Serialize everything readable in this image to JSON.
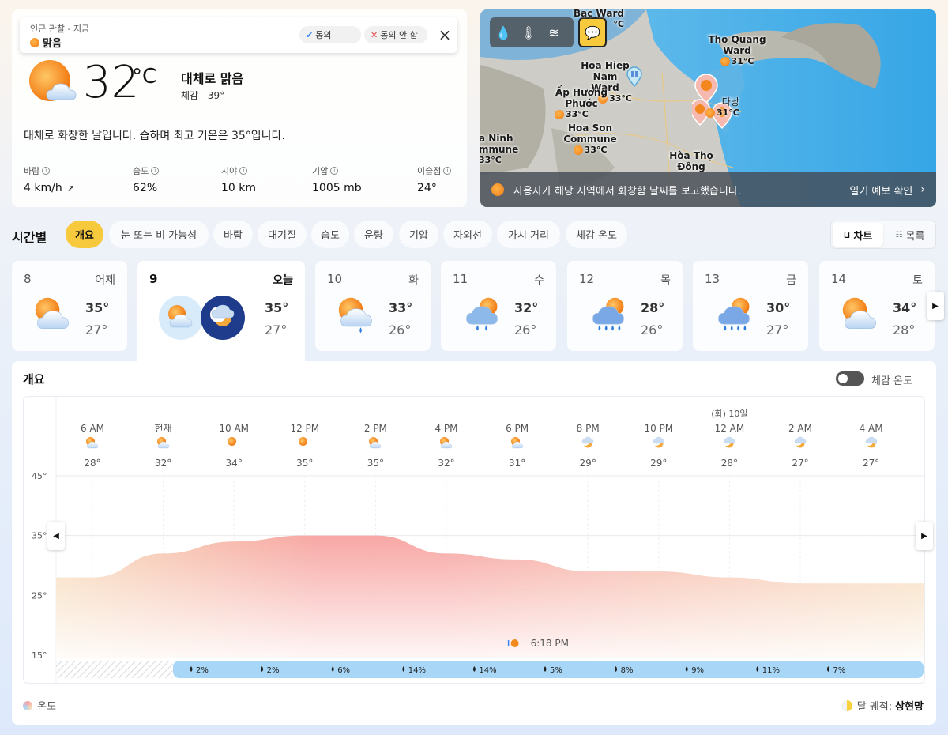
{
  "current": {
    "observation_title": "인근 관찰 - 지금",
    "observation_condition": "맑음",
    "agree_label": "동의",
    "disagree_label": "동의 안 함",
    "temperature": "32",
    "unit": "°C",
    "condition": "대체로 맑음",
    "feels_like_label": "체감",
    "feels_like_value": "39°",
    "description": "대체로 화창한 날입니다. 습하며 최고 기온은 35°입니다.",
    "metrics": [
      {
        "label": "바람",
        "value": "4 km/h"
      },
      {
        "label": "습도",
        "value": "62%"
      },
      {
        "label": "시야",
        "value": "10 km"
      },
      {
        "label": "기압",
        "value": "1005 mb"
      },
      {
        "label": "이슬점",
        "value": "24°"
      }
    ]
  },
  "map": {
    "places": [
      {
        "name": "Bac Ward",
        "temp": "°C"
      },
      {
        "name": "Tho Quang Ward",
        "temp": "31°C"
      },
      {
        "name": "Hoa Hiep Nam Ward",
        "temp": "33°C"
      },
      {
        "name": "Ấp Hương Phước",
        "temp": "33°C"
      },
      {
        "name": "다낭",
        "temp": "31°C"
      },
      {
        "name": "Hoa Son Commune",
        "temp": "33°C"
      },
      {
        "name": "a Ninh mmune",
        "temp": "33°C"
      },
      {
        "name": "Hòa Thọ Đông",
        "temp": ""
      }
    ],
    "footer_text": "사용자가 해당 지역에서 화창함 날씨를 보고했습니다.",
    "footer_link": "일기 예보 확인"
  },
  "hourly": {
    "title": "시간별",
    "tabs": [
      "개요",
      "눈 또는 비 가능성",
      "바람",
      "대기질",
      "습도",
      "운량",
      "기압",
      "자외선",
      "가시 거리",
      "체감 온도"
    ],
    "active_tab": 0,
    "view_chart": "차트",
    "view_list": "목록"
  },
  "days": [
    {
      "num": "8",
      "name": "어제",
      "hi": "35°",
      "lo": "27°",
      "icon": "partly-sunny"
    },
    {
      "num": "9",
      "name": "오늘",
      "hi": "35°",
      "lo": "27°",
      "icon": "partly-sunny-night"
    },
    {
      "num": "10",
      "name": "화",
      "hi": "33°",
      "lo": "26°",
      "icon": "sun-rain"
    },
    {
      "num": "11",
      "name": "수",
      "hi": "32°",
      "lo": "26°",
      "icon": "rain"
    },
    {
      "num": "12",
      "name": "목",
      "hi": "28°",
      "lo": "26°",
      "icon": "heavy-rain"
    },
    {
      "num": "13",
      "name": "금",
      "hi": "30°",
      "lo": "27°",
      "icon": "heavy-rain"
    },
    {
      "num": "14",
      "name": "토",
      "hi": "34°",
      "lo": "28°",
      "icon": "partly-sunny"
    }
  ],
  "overview": {
    "title": "개요",
    "feels_toggle_label": "체감 온도",
    "sunset": "6:18 PM",
    "legend_left": "온도",
    "moon_label": "달 궤적:",
    "moon_phase": "상현망"
  },
  "chart_data": {
    "type": "area",
    "title": "",
    "xlabel": "",
    "ylabel": "",
    "ylim": [
      15,
      45
    ],
    "yticks": [
      "45°",
      "35°",
      "25°",
      "15°"
    ],
    "date_marker": "(화) 10일",
    "hours": [
      "6 AM",
      "현재",
      "10 AM",
      "12 PM",
      "2 PM",
      "4 PM",
      "6 PM",
      "8 PM",
      "10 PM",
      "12 AM",
      "2 AM",
      "4 AM"
    ],
    "hour_icons": [
      "partly-sunny",
      "partly-sunny",
      "sun",
      "sun",
      "partly-sunny",
      "partly-sunny",
      "partly-sunny",
      "partly-cloudy-night",
      "partly-cloudy-night",
      "partly-cloudy-night",
      "partly-cloudy-night",
      "partly-cloudy-night"
    ],
    "temps": [
      28,
      32,
      34,
      35,
      35,
      32,
      31,
      29,
      29,
      28,
      27,
      27
    ],
    "temp_labels": [
      "28°",
      "32°",
      "34°",
      "35°",
      "35°",
      "32°",
      "31°",
      "29°",
      "29°",
      "28°",
      "27°",
      "27°"
    ],
    "precip": [
      "2%",
      "2%",
      "6%",
      "14%",
      "14%",
      "5%",
      "8%",
      "9%",
      "11%",
      "7%"
    ],
    "colors": {
      "hot": "#f7a3a0",
      "warm": "#f6d9b7",
      "precip": "#a7d6f7"
    }
  }
}
